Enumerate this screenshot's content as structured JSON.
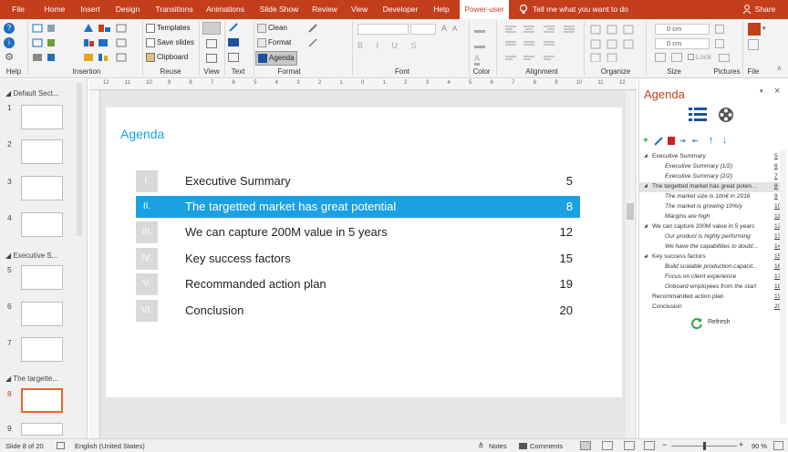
{
  "tabs": [
    "File",
    "Home",
    "Insert",
    "Design",
    "Transitions",
    "Animations",
    "Slide Show",
    "Review",
    "View",
    "Developer",
    "Help",
    "Power-user"
  ],
  "tell_me": "Tell me what you want to do",
  "share": "Share",
  "ribbon": {
    "groups": {
      "help": "Help",
      "insertion": "Insertion",
      "reuse": "Reuse",
      "view": "View",
      "text": "Text",
      "format": "Format",
      "font": "Font",
      "color": "Color",
      "alignment": "Alignment",
      "organize": "Organize",
      "size": "Size",
      "pictures": "Pictures",
      "file": "File"
    },
    "reuse_buttons": [
      "Templates",
      "Save slides",
      "Clipboard"
    ],
    "format_buttons": [
      "Clean",
      "Format",
      "Agenda"
    ],
    "size_fields": [
      "0 cm",
      "0 cm"
    ],
    "lock": "Lock"
  },
  "sidebar": {
    "sections": [
      "Default Sect...",
      "Executive S...",
      "The targette..."
    ],
    "slide_numbers": [
      "1",
      "2",
      "3",
      "4",
      "5",
      "6",
      "7",
      "8",
      "9"
    ]
  },
  "ruler": [
    "12",
    "11",
    "10",
    "9",
    "8",
    "7",
    "6",
    "5",
    "4",
    "3",
    "2",
    "1",
    "0",
    "1",
    "2",
    "3",
    "4",
    "5",
    "6",
    "7",
    "8",
    "9",
    "10",
    "11",
    "12"
  ],
  "slide": {
    "title": "Agenda",
    "items": [
      {
        "num": "I.",
        "text": "Executive Summary",
        "page": "5"
      },
      {
        "num": "II.",
        "text": "The targetted market has great potential",
        "page": "8"
      },
      {
        "num": "III.",
        "text": "We can capture 200M value in 5 years",
        "page": "12"
      },
      {
        "num": "IV.",
        "text": "Key success factors",
        "page": "15"
      },
      {
        "num": "V.",
        "text": "Recommanded action plan",
        "page": "19"
      },
      {
        "num": "VI.",
        "text": "Conclusion",
        "page": "20"
      }
    ],
    "accent": "#1ba1e2"
  },
  "pane": {
    "title": "Agenda",
    "refresh": "Refresh",
    "tree": [
      {
        "text": "Executive Summary",
        "page": "5",
        "level": 0
      },
      {
        "text": "Executive Summary (1/2)",
        "page": "6",
        "level": 1
      },
      {
        "text": "Executive Summary (2/2)",
        "page": "7",
        "level": 1
      },
      {
        "text": "The targetted market has great poten...",
        "page": "8",
        "level": 0
      },
      {
        "text": "The market size is 1bn€ in 2018",
        "page": "9",
        "level": 1
      },
      {
        "text": "The market is growing 10%/y",
        "page": "10",
        "level": 1
      },
      {
        "text": "Margins are high",
        "page": "11",
        "level": 1
      },
      {
        "text": "We can capture 200M value in 5 years",
        "page": "12",
        "level": 0
      },
      {
        "text": "Our product is highly performing",
        "page": "13",
        "level": 1
      },
      {
        "text": "We have the capabilities to doubl...",
        "page": "14",
        "level": 1
      },
      {
        "text": "Key success factors",
        "page": "15",
        "level": 0
      },
      {
        "text": "Build scalable production capacit...",
        "page": "16",
        "level": 1
      },
      {
        "text": "Focus on client experience",
        "page": "17",
        "level": 1
      },
      {
        "text": "Onboard employees from the start",
        "page": "18",
        "level": 1
      },
      {
        "text": "Recommanded action plan",
        "page": "19",
        "level": 0
      },
      {
        "text": "Conclusion",
        "page": "20",
        "level": 0
      }
    ]
  },
  "status": {
    "slide": "Slide 8 of 20",
    "lang": "English (United States)",
    "notes": "Notes",
    "comments": "Comments",
    "zoom": "90 %"
  },
  "colors": {
    "brand": "#c43e1c",
    "accent": "#1ba1e2",
    "link": "#0d63a5"
  }
}
